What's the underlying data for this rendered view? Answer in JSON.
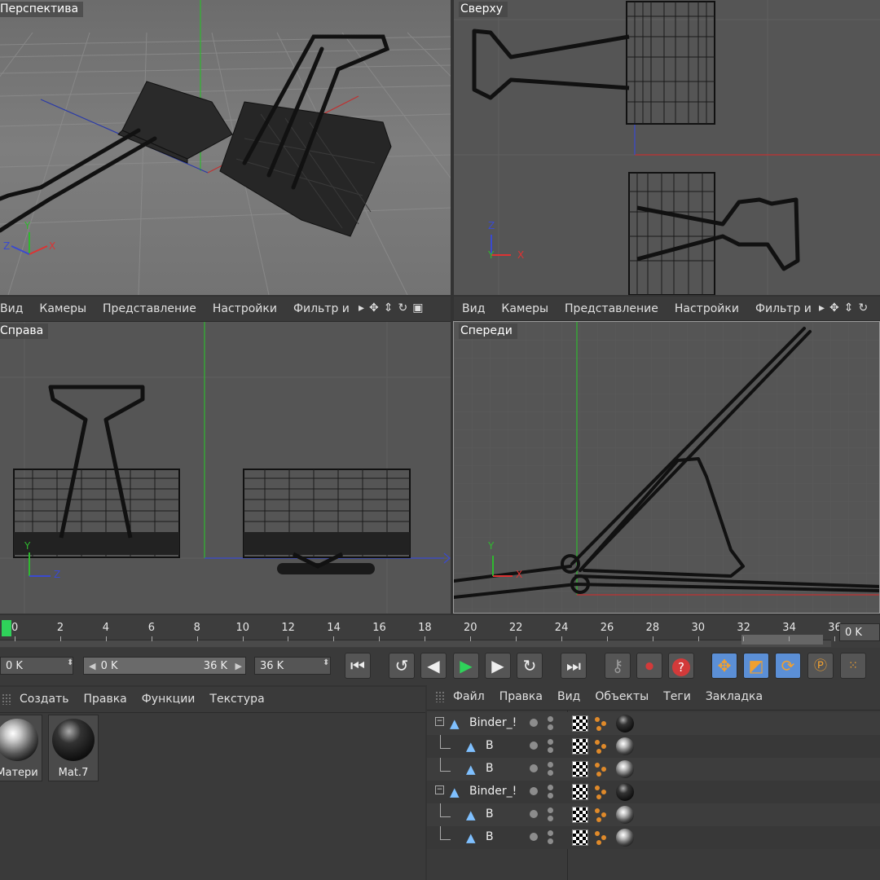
{
  "viewports": {
    "perspective": {
      "title": "Перспектива"
    },
    "top": {
      "title": "Сверху"
    },
    "right": {
      "title": "Справа"
    },
    "front": {
      "title": "Спереди"
    }
  },
  "viewport_menu": {
    "items": [
      "Вид",
      "Камеры",
      "Представление",
      "Настройки",
      "Фильтр и"
    ],
    "icons": [
      "play-arrow-icon",
      "move-icon",
      "updown-icon",
      "rotate-icon",
      "maximize-icon"
    ]
  },
  "axis_labels": {
    "x": "X",
    "y": "Y",
    "z": "Z"
  },
  "timeline": {
    "ticks": [
      "0",
      "2",
      "4",
      "6",
      "8",
      "10",
      "12",
      "14",
      "16",
      "18",
      "20",
      "22",
      "24",
      "26",
      "28",
      "30",
      "32",
      "34",
      "36"
    ],
    "current_frame_display": "0 K"
  },
  "controls": {
    "start_field": "0 K",
    "range_start": "0 K",
    "range_end": "36 K",
    "end_field": "36 K"
  },
  "material_manager": {
    "menu": [
      "Создать",
      "Правка",
      "Функции",
      "Текстура"
    ],
    "materials": [
      {
        "name": "Матери"
      },
      {
        "name": "Mat.7"
      }
    ]
  },
  "object_manager": {
    "menu": [
      "Файл",
      "Правка",
      "Вид",
      "Объекты",
      "Теги",
      "Закладка"
    ],
    "objects": [
      {
        "name": "Binder_!",
        "level": 0
      },
      {
        "name": "B",
        "level": 1
      },
      {
        "name": "B",
        "level": 1
      },
      {
        "name": "Binder_!",
        "level": 0
      },
      {
        "name": "B",
        "level": 1
      },
      {
        "name": "B",
        "level": 1
      }
    ]
  },
  "colors": {
    "accent_blue": "#5b8fd6",
    "record_red": "#d23a3a",
    "play_green": "#2fd25a"
  }
}
